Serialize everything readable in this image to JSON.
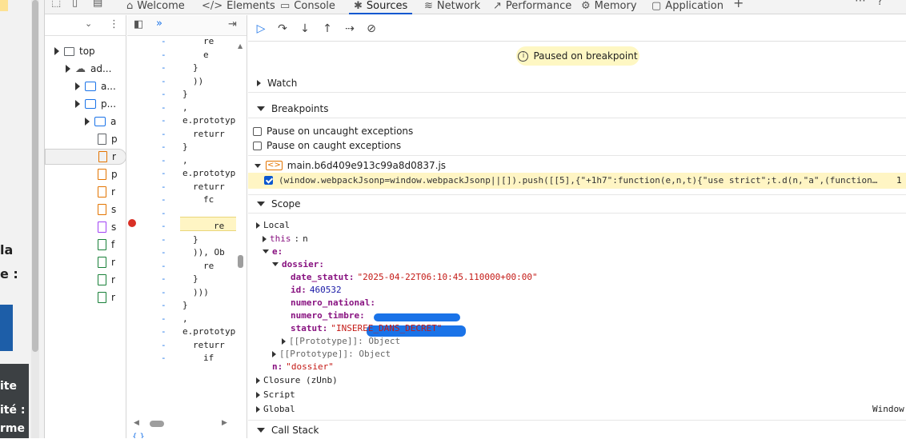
{
  "page_strip": {
    "texts": [
      "la",
      "e :",
      "ite",
      "ité :",
      "rme"
    ]
  },
  "tabs": [
    {
      "label": "Welcome",
      "icon": "home-icon"
    },
    {
      "label": "Elements",
      "icon": "code-brackets-icon"
    },
    {
      "label": "Console",
      "icon": "console-icon"
    },
    {
      "label": "Sources",
      "icon": "bug-icon",
      "active": true
    },
    {
      "label": "Network",
      "icon": "wifi-icon"
    },
    {
      "label": "Performance",
      "icon": "performance-icon"
    },
    {
      "label": "Memory",
      "icon": "memory-chip-icon"
    },
    {
      "label": "Application",
      "icon": "application-icon"
    }
  ],
  "navigator": {
    "top_label": "top",
    "items": [
      {
        "label": "ad..."
      },
      {
        "label": "a..."
      },
      {
        "label": "p..."
      },
      {
        "label": "a"
      },
      {
        "label": "p"
      },
      {
        "label": "r"
      },
      {
        "label": "p"
      },
      {
        "label": "r"
      },
      {
        "label": "s"
      },
      {
        "label": "s"
      },
      {
        "label": "f"
      },
      {
        "label": "r"
      },
      {
        "label": "r"
      },
      {
        "label": "r"
      }
    ]
  },
  "editor": {
    "lines": [
      "re",
      "e",
      "}",
      "))",
      "}",
      ",",
      "e.prototyp",
      "returr",
      "}",
      ",",
      "e.prototyp",
      "returr",
      "fc",
      "",
      "re",
      "}",
      ")), Ob",
      "re",
      "}",
      ")))",
      "}",
      ",",
      "e.prototyp",
      "returr",
      "if"
    ],
    "dash": "-",
    "bottom_text": "{ }"
  },
  "debugger": {
    "paused_text": "Paused on breakpoint",
    "sections": {
      "watch": "Watch",
      "breakpoints": "Breakpoints",
      "scope": "Scope",
      "call_stack": "Call Stack"
    },
    "pause_uncaught": "Pause on uncaught exceptions",
    "pause_caught": "Pause on caught exceptions",
    "bp_file": "main.b6d409e913c99a8d0837.js",
    "bp_code": "(window.webpackJsonp=window.webpackJsonp||[]).push([[5],{\"+1h7\":function(e,n,t){\"use strict\";t.d(n,\"a\",(function…",
    "bp_line": "1",
    "scope": {
      "local": "Local",
      "this_key": "this",
      "this_val": "n",
      "e_key": "e:",
      "dossier_key": "dossier:",
      "date_statut_key": "date_statut:",
      "date_statut_val": "\"2025-04-22T06:10:45.110000+00:00\"",
      "id_key": "id:",
      "id_val": "460532",
      "numero_national_key": "numero_national:",
      "numero_timbre_key": "numero_timbre:",
      "statut_key": "statut:",
      "statut_val": "\"INSEREE_DANS_DECRET\"",
      "proto_inner": "[[Prototype]]: Object",
      "proto_outer": "[[Prototype]]: Object",
      "n_key": "n:",
      "n_val": "\"dossier\"",
      "closure": "Closure (zUnb)",
      "script": "Script",
      "global": "Global",
      "global_val": "Window"
    }
  }
}
